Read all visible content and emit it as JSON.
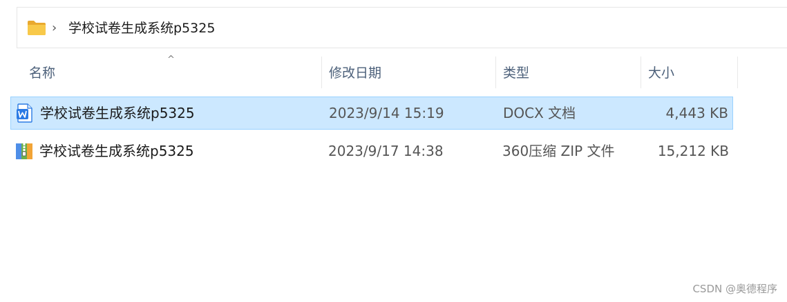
{
  "address": {
    "path_separator": "›",
    "current_folder": "学校试卷生成系统p5325"
  },
  "columns": {
    "sort_indicator": "^",
    "name": "名称",
    "modified": "修改日期",
    "type": "类型",
    "size": "大小"
  },
  "files": [
    {
      "name": "学校试卷生成系统p5325",
      "modified": "2023/9/14 15:19",
      "type": "DOCX 文档",
      "size": "4,443 KB",
      "icon": "word-document-icon",
      "selected": true
    },
    {
      "name": "学校试卷生成系统p5325",
      "modified": "2023/9/17 14:38",
      "type": "360压缩 ZIP 文件",
      "size": "15,212 KB",
      "icon": "zip-archive-icon",
      "selected": false
    }
  ],
  "watermark": "CSDN @奥德程序",
  "colors": {
    "selection_bg": "#cce8ff",
    "selection_border": "#99d1ff",
    "header_text": "#4c607a",
    "folder_yellow": "#f8c94a",
    "word_blue": "#2b7ae4",
    "zip_blue": "#2f6fd6",
    "zip_orange": "#f2a436"
  }
}
